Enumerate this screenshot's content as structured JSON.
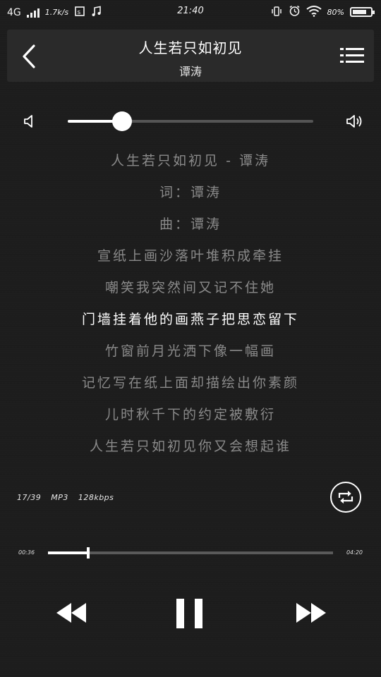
{
  "status_bar": {
    "network": "4G",
    "speed": "1.7k/s",
    "time": "21:40",
    "battery_pct": "80%",
    "battery_level": 0.8
  },
  "header": {
    "title": "人生若只如初见",
    "artist": "谭涛"
  },
  "volume": {
    "level": 0.22
  },
  "lyrics": {
    "lines": [
      "人生若只如初见 - 谭涛",
      "词：谭涛",
      "曲：谭涛",
      "宣纸上画沙落叶堆积成牵挂",
      "嘲笑我突然间又记不住她",
      "门墙挂着他的画燕子把思恋留下",
      "竹窗前月光洒下像一幅画",
      "记忆写在纸上面却描绘出你素颜",
      "儿时秋千下的约定被敷衍",
      "人生若只如初见你又会想起谁"
    ],
    "active_index": 5
  },
  "track_info": {
    "position": "17/39",
    "format": "MP3",
    "bitrate": "128kbps"
  },
  "progress": {
    "current": "00:36",
    "total": "04:20",
    "fraction": 0.14
  },
  "icons": {
    "back": "chevron-left-icon",
    "menu": "list-menu-icon",
    "volume_low": "speaker-low-icon",
    "volume_high": "speaker-high-icon",
    "repeat": "repeat-icon",
    "prev": "rewind-icon",
    "pause": "pause-icon",
    "next": "fast-forward-icon"
  },
  "colors": {
    "background": "#1c1c1c",
    "header_bg": "#2a2a2a",
    "lyric_inactive": "#8a8a8a",
    "lyric_active": "#ffffff"
  }
}
